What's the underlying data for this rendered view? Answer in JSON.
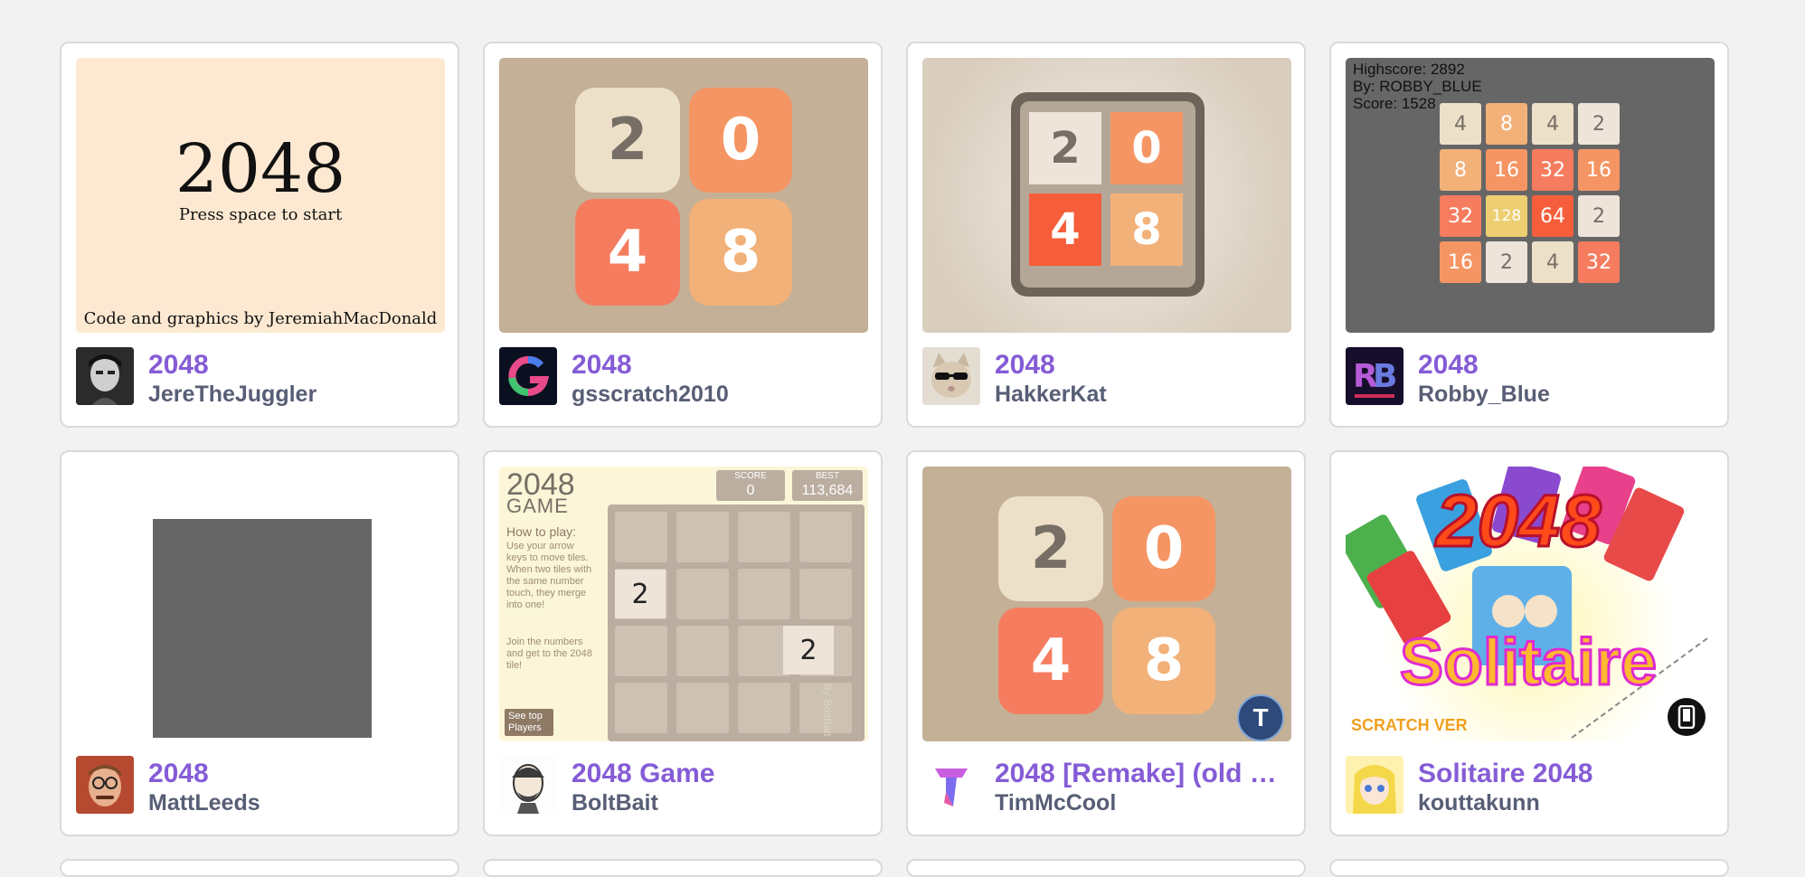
{
  "colors": {
    "title": "#855cd6",
    "author": "#575e75",
    "card_border": "#dadada",
    "background": "#f2f2f2"
  },
  "projects": [
    {
      "title": "2048",
      "author": "JereTheJuggler",
      "thumb": {
        "heading": "2048",
        "subheading": "Press space to start",
        "credit": "Code and graphics by JeremiahMacDonald"
      },
      "avatar_icon": "person-photo"
    },
    {
      "title": "2048",
      "author": "gsscratch2010",
      "thumb": {
        "tiles": [
          "2",
          "0",
          "4",
          "8"
        ]
      },
      "avatar_icon": "g-logo"
    },
    {
      "title": "2048",
      "author": "HakkerKat",
      "thumb": {
        "tiles": [
          "2",
          "0",
          "4",
          "8"
        ]
      },
      "avatar_icon": "cat-with-sunglasses"
    },
    {
      "title": "2048",
      "author": "Robby_Blue",
      "thumb": {
        "highscore": "Highscore: 2892",
        "by": "By: ROBBY_BLUE",
        "score": "Score: 1528",
        "grid": [
          "4",
          "8",
          "4",
          "2",
          "8",
          "16",
          "32",
          "16",
          "32",
          "128",
          "64",
          "2",
          "16",
          "2",
          "4",
          "32"
        ]
      },
      "avatar_icon": "rb-logo"
    },
    {
      "title": "2048",
      "author": "MattLeeds",
      "thumb": {},
      "avatar_icon": "person-photo"
    },
    {
      "title": "2048 Game",
      "author": "BoltBait",
      "thumb": {
        "heading": "2048",
        "subheading": "GAME",
        "score_label": "SCORE",
        "score_value": "0",
        "best_label": "BEST",
        "best_value": "113,684",
        "howto_title": "How to play:",
        "howto_text": "Use your arrow keys to move tiles. When two tiles with the same number touch, they merge into one!",
        "howto_text2": "Join the numbers and get to the 2048 tile!",
        "see_top": "See top Players",
        "byline": "By BoltBait",
        "tile_a": "2",
        "tile_b": "2"
      },
      "avatar_icon": "person-sketch"
    },
    {
      "title": "2048 [Remake] (old p…",
      "author": "TimMcCool",
      "thumb": {
        "tiles": [
          "2",
          "0",
          "4",
          "8"
        ],
        "badge": "T"
      },
      "avatar_icon": "t-logo"
    },
    {
      "title": "Solitaire 2048",
      "author": "kouttakunn",
      "thumb": {
        "heading": "2048",
        "subheading": "Solitaire",
        "tag": "SCRATCH VER"
      },
      "avatar_icon": "anime-girl"
    }
  ]
}
